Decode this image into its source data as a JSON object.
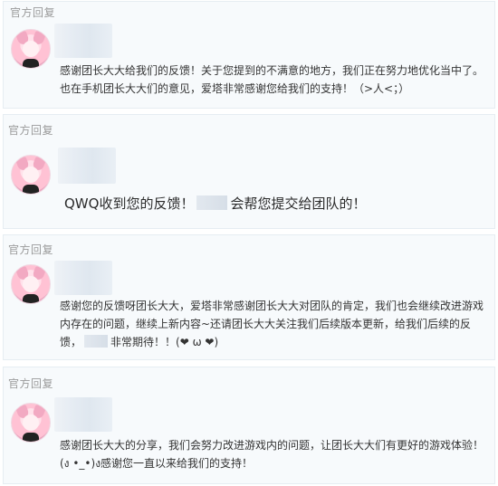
{
  "replies": [
    {
      "header": "官方回复",
      "text": "感谢团长大大给我们的反馈！关于您提到的不满意的地方，我们正在努力地优化当中了。也在手机团长大大们的意见，爱塔非常感谢您给我们的支持！（>人<；）"
    },
    {
      "header": "官方回复",
      "text_before": "QWQ收到您的反馈！",
      "text_after": "会帮您提交给团队的！"
    },
    {
      "header": "官方回复",
      "text_before": "感谢您的反馈呀团长大大，爱塔非常感谢团长大大对团队的肯定，我们也会继续改进游戏内存在的问题，继续上新内容~还请团长大大关注我们后续版本更新，给我们后续的反馈，",
      "text_after": "非常期待！！(❤ ω ❤)"
    },
    {
      "header": "官方回复",
      "text": "感谢团长大大的分享，我们会努力改进游戏内的问题，让团长大大们有更好的游戏体验！(ง •_•)ง感谢您一直以来给我们的支持！"
    }
  ]
}
